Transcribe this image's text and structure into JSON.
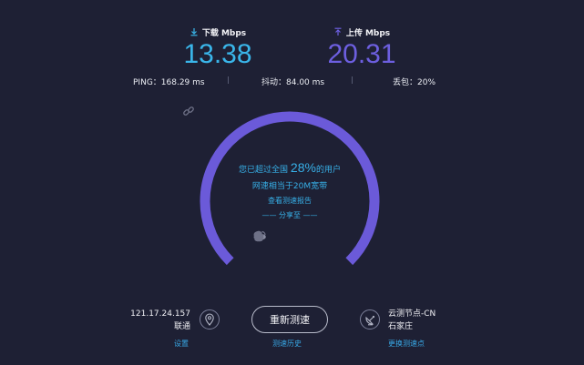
{
  "download": {
    "label": "下载 Mbps",
    "value": "13.38",
    "icon": "download-icon",
    "color": "#3ab6ea"
  },
  "upload": {
    "label": "上传 Mbps",
    "value": "20.31",
    "icon": "upload-icon",
    "color": "#6d5fe0"
  },
  "stats": {
    "ping": "PING：168.29 ms",
    "jitter": "抖动：84.00 ms",
    "loss": "丢包：20%"
  },
  "gauge": {
    "arc_color": "#6b5ad9",
    "beat_prefix": "您已超过全国",
    "beat_pct": "28%",
    "beat_suffix": "的用户",
    "equivalent": "网速相当于20M宽带",
    "report_link": "查看测速报告",
    "share_to": "—— 分享至 ——",
    "share_icons": [
      "wechat-icon",
      "weibo-icon",
      "qq-icon",
      "favorite-icon"
    ],
    "link_icon": "link-icon"
  },
  "client": {
    "ip": "121.17.24.157",
    "isp": "联通",
    "settings_link": "设置",
    "icon": "location-pin-icon"
  },
  "retest": {
    "label": "重新测速",
    "history_link": "测速历史"
  },
  "server": {
    "node": "云测节点-CN",
    "city": "石家庄",
    "change_link": "更换测速点",
    "icon": "satellite-dish-icon"
  },
  "colors": {
    "background": "#1e2034",
    "accent_blue": "#3ab6ea",
    "accent_purple": "#6d5fe0"
  }
}
